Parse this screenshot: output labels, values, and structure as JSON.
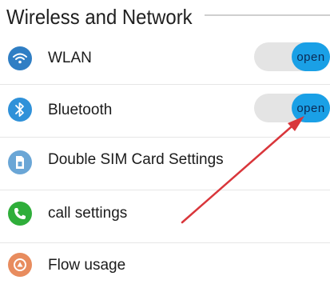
{
  "header": {
    "title": "Wireless and Network"
  },
  "items": [
    {
      "label": "WLAN",
      "icon": "wifi-icon",
      "icon_color": "#2f7ec4",
      "toggle": "open"
    },
    {
      "label": "Bluetooth",
      "icon": "bluetooth-icon",
      "icon_color": "#2f91d9",
      "toggle": "open"
    },
    {
      "label": "Double SIM Card Settings",
      "icon": "sim-card-icon",
      "icon_color": "#6aa6d6"
    },
    {
      "label": "call settings",
      "icon": "phone-icon",
      "icon_color": "#2fae3a"
    },
    {
      "label": "Flow usage",
      "icon": "data-usage-icon",
      "icon_color": "#e88c5e"
    }
  ],
  "colors": {
    "toggle_on": "#1aa0e6",
    "toggle_track": "#e4e4e4",
    "arrow": "#d9363b"
  }
}
